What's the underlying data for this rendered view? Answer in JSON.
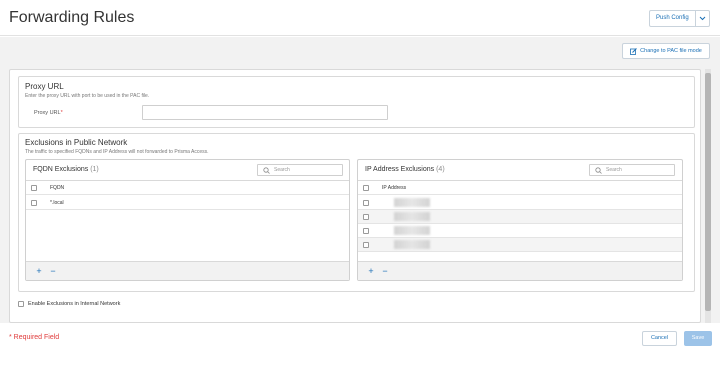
{
  "header": {
    "title": "Forwarding Rules",
    "push_config_label": "Push Config",
    "push_config_caret": "⌄"
  },
  "toolbar": {
    "change_pac_label": "Change to PAC file mode"
  },
  "proxy": {
    "title": "Proxy URL",
    "description": "Enter the proxy URL with port to be used in the PAC file.",
    "field_label": "Proxy URL",
    "required_marker": "*",
    "value": ""
  },
  "exclusions": {
    "title": "Exclusions in Public Network",
    "description": "The traffic to specified FQDNs and IP Address will not forwarded to Prisma Access.",
    "fqdn": {
      "title": "FQDN Exclusions",
      "count": "(1)",
      "search_placeholder": "Search",
      "column": "FQDN",
      "rows": [
        "*.local"
      ]
    },
    "ip": {
      "title": "IP Address Exclusions",
      "count": "(4)",
      "search_placeholder": "Search",
      "column": "IP Address",
      "rows": [
        "",
        "",
        "",
        ""
      ]
    },
    "add_symbol": "+",
    "remove_symbol": "−"
  },
  "internal": {
    "enable_label": "Enable Exclusions in Internal Network",
    "checked": false
  },
  "footer": {
    "required_field": "* Required Field",
    "cancel_label": "Cancel",
    "save_label": "Save"
  },
  "colors": {
    "accent": "#1a6fb5",
    "required": "#e03b3b",
    "save_disabled": "#9cc3e8"
  }
}
